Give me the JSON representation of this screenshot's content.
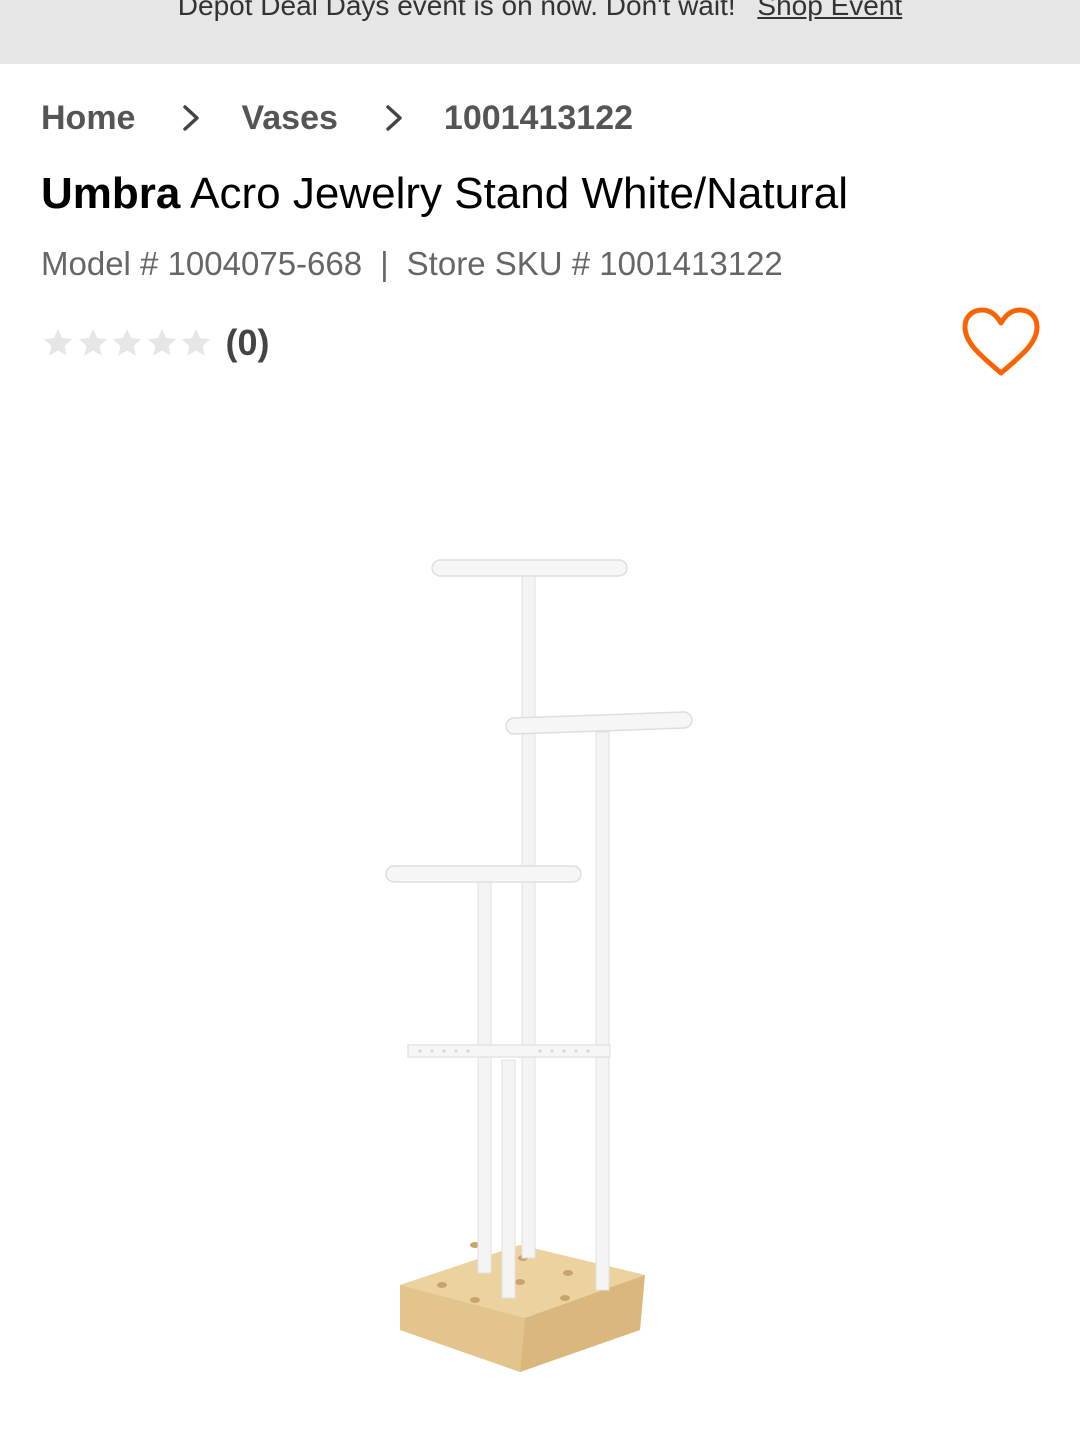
{
  "promo": {
    "text": "Depot Deal Days event is on now. Don't wait!",
    "link_label": "Shop Event"
  },
  "breadcrumb": {
    "items": [
      {
        "label": "Home"
      },
      {
        "label": "Vases"
      },
      {
        "label": "1001413122"
      }
    ]
  },
  "product": {
    "brand": "Umbra",
    "name": "Acro Jewelry Stand White/Natural",
    "model_label": "Model # 1004075-668",
    "divider": "|",
    "sku_label": "Store SKU # 1001413122",
    "rating": {
      "value": 0,
      "max": 5,
      "count_label": "(0)"
    },
    "image_icon": "jewelry-stand-image"
  },
  "colors": {
    "banner_bg": "#e6e6e6",
    "accent": "#f96302",
    "star_empty": "#e6e6e6",
    "wood": "#e9cc98"
  },
  "icons": {
    "breadcrumb_separator": "chevron-right-icon",
    "favorite": "heart-outline-icon",
    "star": "star-icon"
  }
}
